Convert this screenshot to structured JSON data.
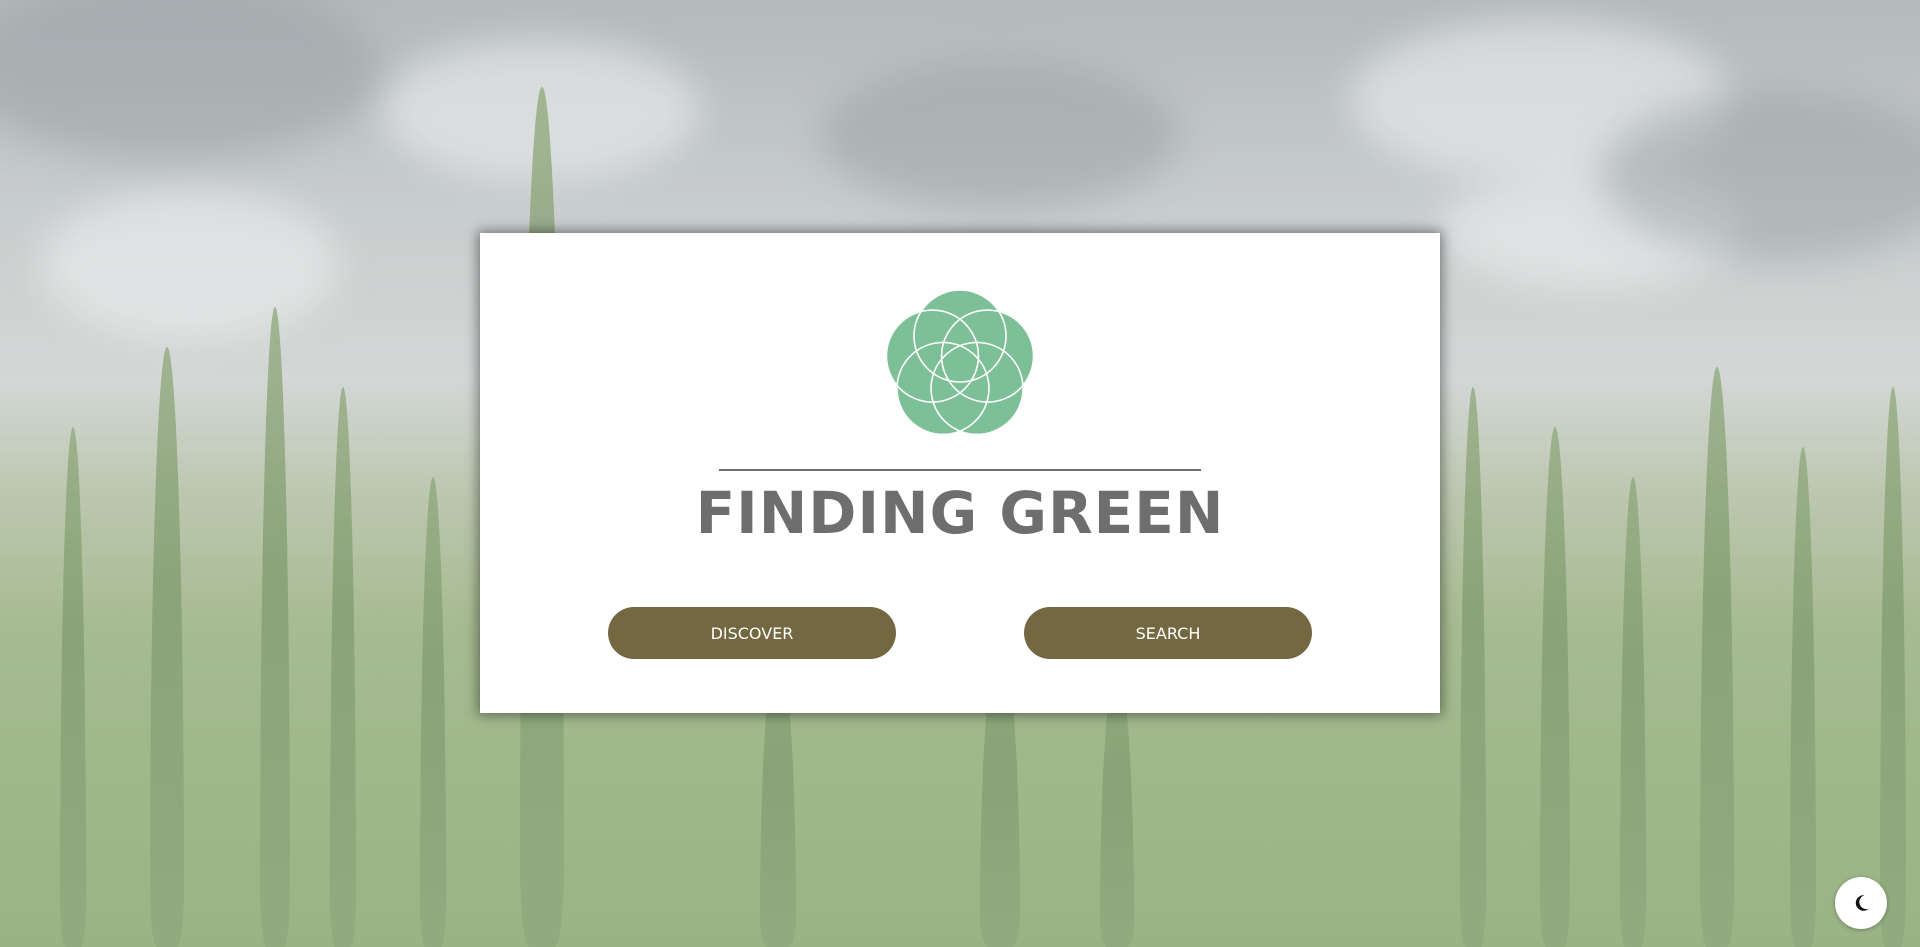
{
  "brand": {
    "title": "FINDING GREEN",
    "logo_icon": "flower-of-circles-logo",
    "logo_color": "#7dbf96"
  },
  "actions": {
    "discover_label": "DISCOVER",
    "search_label": "SEARCH",
    "button_color": "#736841"
  },
  "theme_toggle": {
    "icon": "moon-icon"
  },
  "background": {
    "scene": "cannabis-field-under-cloudy-sky"
  }
}
